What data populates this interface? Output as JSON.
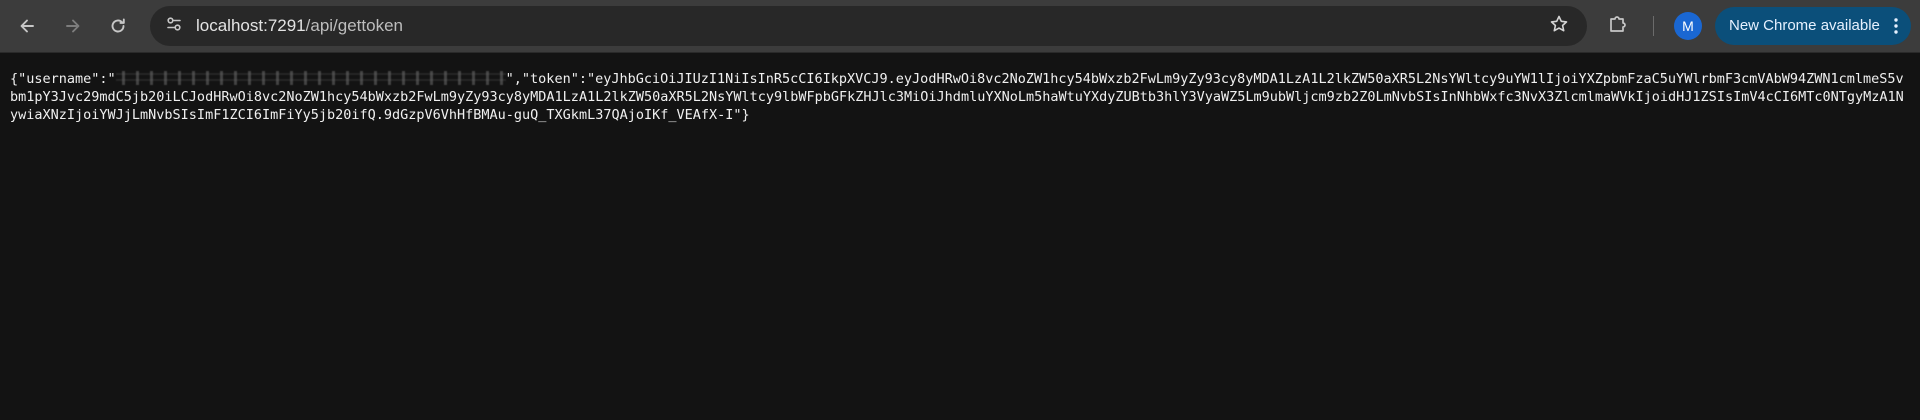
{
  "browser": {
    "url_host": "localhost:7291",
    "url_path": "/api/gettoken",
    "profile_initial": "M",
    "update_chip_label": "New Chrome available",
    "colors": {
      "toolbar": "#3c3c3c",
      "omnibox": "#282828",
      "page_background": "#131313",
      "avatar": "#1a67d2",
      "update_chip": "#0b4f7a"
    },
    "icons": {
      "back": "back-arrow-icon",
      "forward": "forward-arrow-icon",
      "reload": "reload-icon",
      "site_info": "tune-icon",
      "bookmark": "star-icon",
      "extensions": "puzzle-icon",
      "menu": "kebab-menu-icon"
    }
  },
  "page": {
    "json_open": "{\"username\":\"",
    "username_redacted": true,
    "json_middle": "\",\"token\":\"",
    "token": "eyJhbGciOiJIUzI1NiIsInR5cCI6IkpXVCJ9.eyJodHRwOi8vc2NoZW1hcy54bWxzb2FwLm9yZy93cy8yMDA1LzA1L2lkZW50aXR5L2NsYWltcy9uYW1lIjoiYXZpbmFzaC5uYWlrbmF3cmVAbW94ZWN1cmlmeS5vbm1pY3Jvc29mdC5jb20iLCJodHRwOi8vc2NoZW1hcy54bWxzb2FwLm9yZy93cy8yMDA1LzA1L2lkZW50aXR5L2NsYWltcy9lbWFpbGFkZHJlc3MiOiJhdmluYXNoLm5haWtuYXdyZUBtb3hlY3VyaWZ5Lm9ubWljcm9zb2Z0LmNvbSIsInNhbWxfc3NvX3ZlcmlmaWVkIjoidHJ1ZSIsImV4cCI6MTc0NTgyMzA1NywiaXNzIjoiYWJjLmNvbSIsImF1ZCI6ImFiYy5jb20ifQ.9dGzpV6VhHfBMAu-guQ_TXGkmL37QAjoIKf_VEAfX-I",
    "json_close": "\"}"
  }
}
